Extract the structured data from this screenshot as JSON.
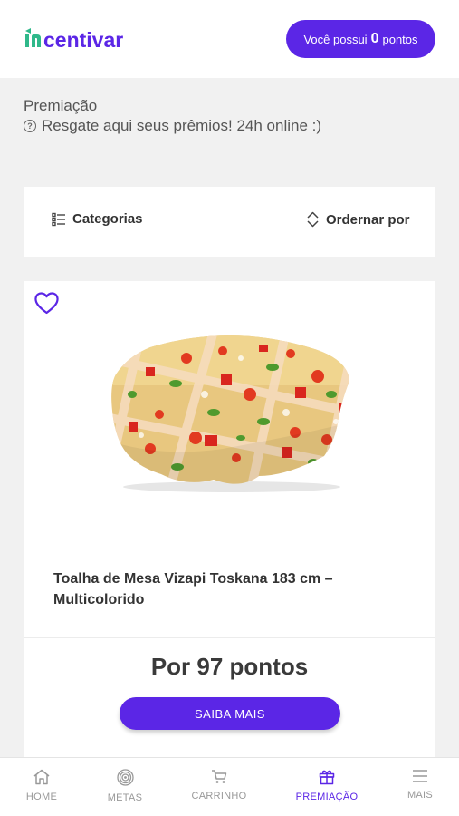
{
  "colors": {
    "primary": "#5b26e6",
    "logo_green": "#2fb88a",
    "background": "#f1f1f1"
  },
  "header": {
    "logo_text": "incentivar",
    "points": {
      "prefix": "Você possui",
      "value": "0",
      "suffix": "pontos"
    }
  },
  "page": {
    "title": "Premiação",
    "subtitle": "Resgate aqui seus prêmios! 24h online :)",
    "subtitle_icon": "help-circle-icon"
  },
  "filters": {
    "categories": {
      "label": "Categorias",
      "icon": "list-icon"
    },
    "sort": {
      "label": "Ordernar por",
      "icon": "sort-icon"
    }
  },
  "product": {
    "favorite_icon": "heart-icon",
    "name": "Toalha de Mesa Vizapi Toskana 183 cm – Multicolorido",
    "price": "Por 97 pontos",
    "button": "SAIBA MAIS"
  },
  "nav": {
    "items": [
      {
        "label": "HOME",
        "icon": "home-icon"
      },
      {
        "label": "METAS",
        "icon": "target-icon"
      },
      {
        "label": "CARRINHO",
        "icon": "cart-icon"
      },
      {
        "label": "PREMIAÇÃO",
        "icon": "gift-icon",
        "active": true
      },
      {
        "label": "MAIS",
        "icon": "menu-icon"
      }
    ]
  }
}
